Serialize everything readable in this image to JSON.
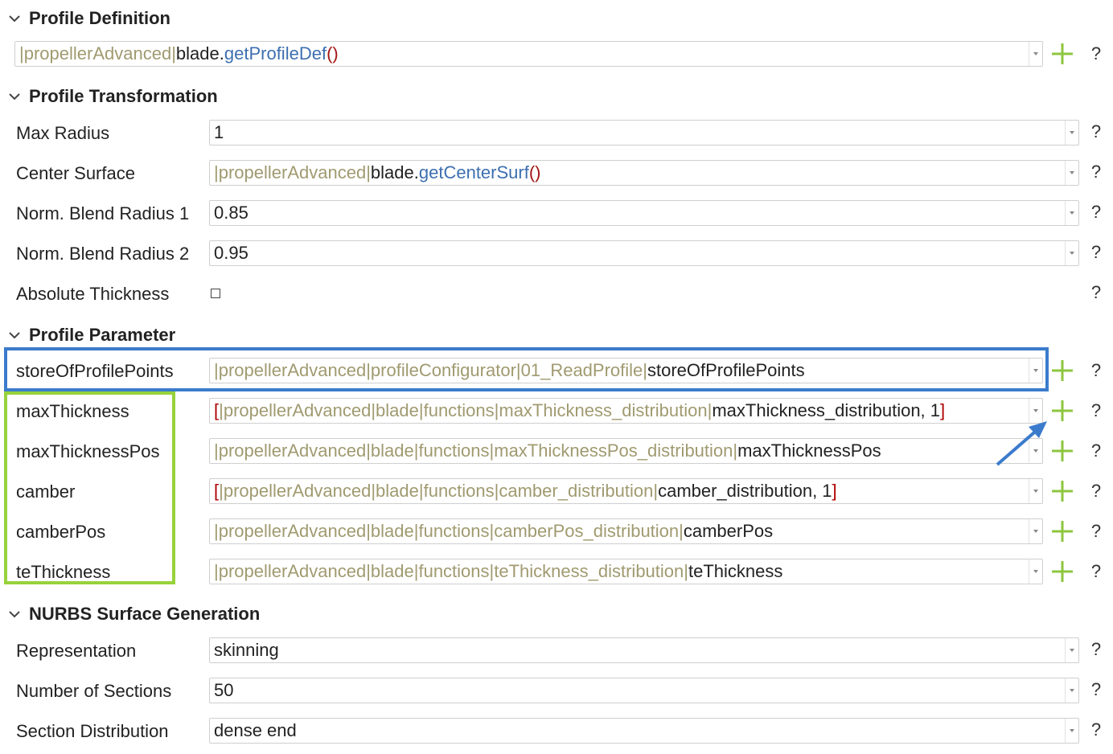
{
  "sections": {
    "profile_definition": "Profile Definition",
    "profile_transformation": "Profile Transformation",
    "profile_parameter": "Profile Parameter",
    "nurbs_surface_generation": "NURBS Surface Generation"
  },
  "profile_definition": {
    "value_path": "propellerAdvanced",
    "value_obj": "blade",
    "value_dot": ".",
    "value_fn": "getProfileDef",
    "value_parens": "()"
  },
  "profile_transformation": {
    "max_radius": {
      "label": "Max Radius",
      "value": "1"
    },
    "center_surface": {
      "label": "Center Surface",
      "value_path": "propellerAdvanced",
      "value_obj": "blade",
      "value_dot": ".",
      "value_fn": "getCenterSurf",
      "value_parens": "()"
    },
    "norm_blend_radius_1": {
      "label": "Norm. Blend Radius 1",
      "value": "0.85"
    },
    "norm_blend_radius_2": {
      "label": "Norm. Blend Radius 2",
      "value": "0.95"
    },
    "absolute_thickness": {
      "label": "Absolute Thickness",
      "checked": false
    }
  },
  "profile_parameter": {
    "store": {
      "label": "storeOfProfilePoints",
      "path": [
        "propellerAdvanced",
        "profileConfigurator",
        "01_ReadProfile"
      ],
      "tail": "storeOfProfilePoints"
    },
    "max_thickness": {
      "label": "maxThickness",
      "open": "[",
      "path": [
        "propellerAdvanced",
        "blade",
        "functions",
        "maxThickness_distribution"
      ],
      "tail": "maxThickness_distribution, 1",
      "close": "]"
    },
    "max_thickness_pos": {
      "label": "maxThicknessPos",
      "path": [
        "propellerAdvanced",
        "blade",
        "functions",
        "maxThicknessPos_distribution"
      ],
      "tail": "maxThicknessPos"
    },
    "camber": {
      "label": "camber",
      "open": "[",
      "path": [
        "propellerAdvanced",
        "blade",
        "functions",
        "camber_distribution"
      ],
      "tail": "camber_distribution, 1",
      "close": "]"
    },
    "camber_pos": {
      "label": "camberPos",
      "path": [
        "propellerAdvanced",
        "blade",
        "functions",
        "camberPos_distribution"
      ],
      "tail": "camberPos"
    },
    "te_thickness": {
      "label": "teThickness",
      "path": [
        "propellerAdvanced",
        "blade",
        "functions",
        "teThickness_distribution"
      ],
      "tail": "teThickness"
    }
  },
  "nurbs": {
    "representation": {
      "label": "Representation",
      "value": "skinning"
    },
    "number_of_sections": {
      "label": "Number of Sections",
      "value": "50"
    },
    "section_distribution": {
      "label": "Section Distribution",
      "value": "dense end"
    }
  },
  "help_symbol": "?",
  "colors": {
    "path_text": "#a09a70",
    "function_text": "#3d6fb0",
    "bracket_text": "#b00000",
    "add_icon": "#8dc63f",
    "highlight_blue": "#3b7bcc",
    "highlight_green": "#97d23c",
    "annotation_arrow": "#3b7bcc"
  },
  "icons": {
    "section_toggle": "chevron-down-icon",
    "add": "plus-icon",
    "help": "question-mark-icon",
    "dropdown": "triangle-down-icon"
  }
}
